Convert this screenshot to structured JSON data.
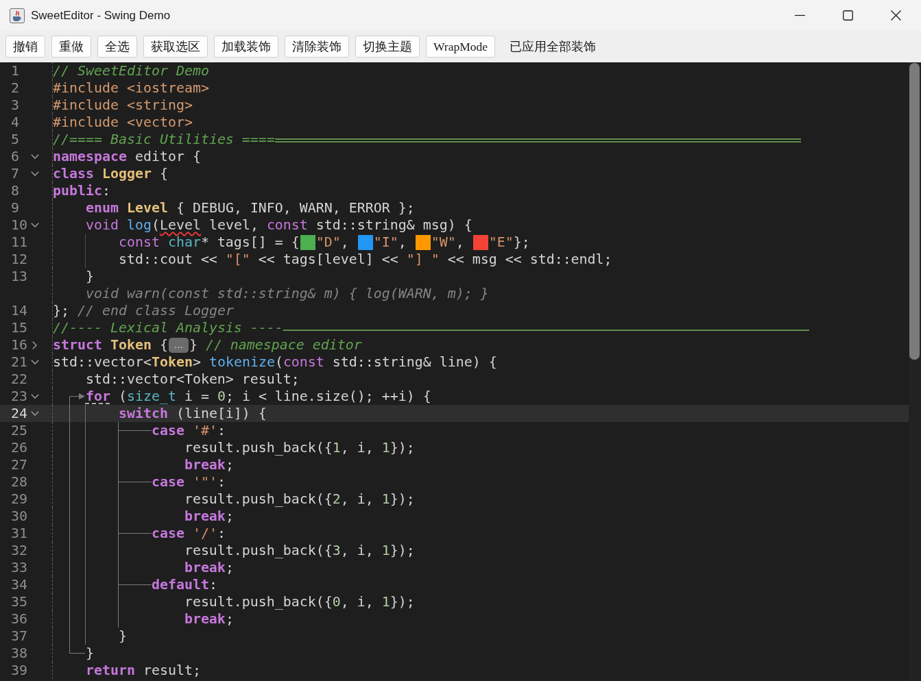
{
  "window": {
    "title": "SweetEditor - Swing Demo"
  },
  "toolbar": {
    "buttons": [
      {
        "label": "撤销"
      },
      {
        "label": "重做"
      },
      {
        "label": "全选"
      },
      {
        "label": "获取选区"
      },
      {
        "label": "加载装饰"
      },
      {
        "label": "清除装饰"
      },
      {
        "label": "切换主题"
      },
      {
        "label": "WrapMode"
      }
    ],
    "status": "已应用全部装饰"
  },
  "editor": {
    "lines": [
      {
        "number": "1",
        "current": false,
        "tokens": [
          {
            "text": "// SweetEditor Demo",
            "kind": "comment"
          }
        ]
      },
      {
        "number": "2",
        "current": false,
        "tokens": [
          {
            "text": "#include <iostream>",
            "kind": "preprocessor"
          }
        ]
      },
      {
        "number": "3",
        "current": false,
        "tokens": [
          {
            "text": "#include <string>",
            "kind": "preprocessor"
          }
        ]
      },
      {
        "number": "4",
        "current": false,
        "tokens": [
          {
            "text": "#include <vector>",
            "kind": "preprocessor"
          }
        ]
      },
      {
        "number": "5",
        "current": false,
        "tokens": [
          {
            "text": "//==== Basic Utilities ====",
            "kind": "comment"
          },
          {
            "kind": "double_rule"
          }
        ]
      },
      {
        "number": "6",
        "current": false,
        "expanded": true,
        "tokens": [
          {
            "text": "namespace ",
            "kind": "keyword"
          },
          {
            "text": "editor {",
            "kind": "plain"
          }
        ]
      },
      {
        "number": "7",
        "current": false,
        "expanded": true,
        "tokens": [
          {
            "text": "class ",
            "kind": "keyword"
          },
          {
            "text": "Logger",
            "kind": "type"
          },
          {
            "text": " {",
            "kind": "plain"
          }
        ]
      },
      {
        "number": "8",
        "current": false,
        "tokens": [
          {
            "text": "public",
            "kind": "keyword"
          },
          {
            "text": ":",
            "kind": "plain"
          }
        ],
        "children": [
          {
            "number": "9",
            "current": false,
            "tokens": [
              {
                "text": "enum ",
                "kind": "keyword"
              },
              {
                "text": "Level",
                "kind": "type"
              },
              {
                "text": " { DEBUG, INFO, WARN, ERROR };",
                "kind": "plain"
              }
            ]
          },
          {
            "number": "10",
            "current": false,
            "expanded": true,
            "tokens": [
              {
                "text": "void ",
                "kind": "modifier"
              },
              {
                "text": "log",
                "kind": "function"
              },
              {
                "text": "(",
                "kind": "plain"
              },
              {
                "text": "Level",
                "kind": "plain",
                "error": true
              },
              {
                "text": " level, ",
                "kind": "plain"
              },
              {
                "text": "const ",
                "kind": "modifier"
              },
              {
                "text": "std::string& msg) {",
                "kind": "plain"
              }
            ],
            "children": [
              {
                "number": "11",
                "current": false,
                "tokens": [
                  {
                    "text": "const ",
                    "kind": "modifier"
                  },
                  {
                    "text": "char",
                    "kind": "builtin"
                  },
                  {
                    "text": "* tags[] = {",
                    "kind": "plain"
                  },
                  {
                    "kind": "swatch",
                    "color": "#4caf50"
                  },
                  {
                    "text": "\"D\"",
                    "kind": "string"
                  },
                  {
                    "text": ", ",
                    "kind": "plain"
                  },
                  {
                    "kind": "swatch",
                    "color": "#2196f3"
                  },
                  {
                    "text": "\"I\"",
                    "kind": "string"
                  },
                  {
                    "text": ", ",
                    "kind": "plain"
                  },
                  {
                    "kind": "swatch",
                    "color": "#ff9800"
                  },
                  {
                    "text": "\"W\"",
                    "kind": "string"
                  },
                  {
                    "text": ", ",
                    "kind": "plain"
                  },
                  {
                    "kind": "swatch",
                    "color": "#f44336"
                  },
                  {
                    "text": "\"E\"",
                    "kind": "string"
                  },
                  {
                    "text": "};",
                    "kind": "plain"
                  }
                ]
              },
              {
                "number": "12",
                "current": false,
                "tokens": [
                  {
                    "text": "std::cout << ",
                    "kind": "plain"
                  },
                  {
                    "text": "\"[\"",
                    "kind": "string"
                  },
                  {
                    "text": " << tags[level] << ",
                    "kind": "plain"
                  },
                  {
                    "text": "\"] \"",
                    "kind": "string"
                  },
                  {
                    "text": " << msg << std::endl;",
                    "kind": "plain"
                  }
                ]
              }
            ]
          },
          {
            "number": "13",
            "current": false,
            "tokens": [
              {
                "text": "}",
                "kind": "plain"
              }
            ]
          },
          {
            "current": false,
            "tokens": [
              {
                "text": "void warn(const std::string& m) { log(WARN, m); }",
                "kind": "ghost"
              }
            ]
          }
        ]
      },
      {
        "number": "14",
        "current": false,
        "tokens": [
          {
            "text": "}; ",
            "kind": "plain"
          },
          {
            "text": "// end class Logger",
            "kind": "ghost"
          }
        ]
      },
      {
        "number": "15",
        "current": false,
        "tokens": [
          {
            "text": "//---- Lexical Analysis ----",
            "kind": "comment"
          },
          {
            "kind": "single_rule"
          }
        ]
      },
      {
        "number": "16",
        "current": false,
        "expanded": false,
        "tokens": [
          {
            "text": "struct ",
            "kind": "keyword"
          },
          {
            "text": "Token",
            "kind": "type"
          },
          {
            "text": " {",
            "kind": "plain"
          },
          {
            "text": "…",
            "kind": "fold_placeholder"
          },
          {
            "text": "} ",
            "kind": "plain"
          },
          {
            "text": "// namespace editor",
            "kind": "comment"
          }
        ]
      },
      {
        "number": "21",
        "current": false,
        "expanded": true,
        "tokens": [
          {
            "text": "std::vector<",
            "kind": "plain"
          },
          {
            "text": "Token",
            "kind": "type"
          },
          {
            "text": "> ",
            "kind": "plain"
          },
          {
            "text": "tokenize",
            "kind": "function"
          },
          {
            "text": "(",
            "kind": "plain"
          },
          {
            "text": "const ",
            "kind": "modifier"
          },
          {
            "text": "std::string& line) {",
            "kind": "plain"
          }
        ],
        "children": [
          {
            "number": "22",
            "current": false,
            "tokens": [
              {
                "text": "std::vector<Token> result;",
                "kind": "plain"
              }
            ]
          },
          {
            "number": "23",
            "current": false,
            "expanded": true,
            "tokens": [
              {
                "text": "for",
                "kind": "keyword",
                "underline": true
              },
              {
                "text": " (",
                "kind": "plain"
              },
              {
                "text": "size_t",
                "kind": "builtin"
              },
              {
                "text": " i = ",
                "kind": "plain"
              },
              {
                "text": "0",
                "kind": "number"
              },
              {
                "text": "; i < line.size(); ++i) {",
                "kind": "plain"
              }
            ],
            "children": [
              {
                "number": "24",
                "current": true,
                "expanded": true,
                "tokens": [
                  {
                    "text": "switch ",
                    "kind": "keyword"
                  },
                  {
                    "text": "(line[i]) {",
                    "kind": "plain"
                  }
                ],
                "children": [
                  {
                    "number": "25",
                    "current": false,
                    "tokens": [
                      {
                        "text": "case ",
                        "kind": "keyword"
                      },
                      {
                        "text": "'#'",
                        "kind": "string"
                      },
                      {
                        "text": ":",
                        "kind": "plain"
                      }
                    ],
                    "children": [
                      {
                        "number": "26",
                        "current": false,
                        "tokens": [
                          {
                            "text": "result.push_back({",
                            "kind": "plain"
                          },
                          {
                            "text": "1",
                            "kind": "number"
                          },
                          {
                            "text": ", i, ",
                            "kind": "plain"
                          },
                          {
                            "text": "1",
                            "kind": "number"
                          },
                          {
                            "text": "});",
                            "kind": "plain"
                          }
                        ]
                      },
                      {
                        "number": "27",
                        "current": false,
                        "tokens": [
                          {
                            "text": "break",
                            "kind": "keyword"
                          },
                          {
                            "text": ";",
                            "kind": "plain"
                          }
                        ]
                      }
                    ]
                  },
                  {
                    "number": "28",
                    "current": false,
                    "tokens": [
                      {
                        "text": "case ",
                        "kind": "keyword"
                      },
                      {
                        "text": "'\"'",
                        "kind": "string"
                      },
                      {
                        "text": ":",
                        "kind": "plain"
                      }
                    ],
                    "children": [
                      {
                        "number": "29",
                        "current": false,
                        "tokens": [
                          {
                            "text": "result.push_back({",
                            "kind": "plain"
                          },
                          {
                            "text": "2",
                            "kind": "number"
                          },
                          {
                            "text": ", i, ",
                            "kind": "plain"
                          },
                          {
                            "text": "1",
                            "kind": "number"
                          },
                          {
                            "text": "});",
                            "kind": "plain"
                          }
                        ]
                      },
                      {
                        "number": "30",
                        "current": false,
                        "tokens": [
                          {
                            "text": "break",
                            "kind": "keyword"
                          },
                          {
                            "text": ";",
                            "kind": "plain"
                          }
                        ]
                      }
                    ]
                  },
                  {
                    "number": "31",
                    "current": false,
                    "tokens": [
                      {
                        "text": "case ",
                        "kind": "keyword"
                      },
                      {
                        "text": "'/'",
                        "kind": "string"
                      },
                      {
                        "text": ":",
                        "kind": "plain"
                      }
                    ],
                    "children": [
                      {
                        "number": "32",
                        "current": false,
                        "tokens": [
                          {
                            "text": "result.push_back({",
                            "kind": "plain"
                          },
                          {
                            "text": "3",
                            "kind": "number"
                          },
                          {
                            "text": ", i, ",
                            "kind": "plain"
                          },
                          {
                            "text": "1",
                            "kind": "number"
                          },
                          {
                            "text": "});",
                            "kind": "plain"
                          }
                        ]
                      },
                      {
                        "number": "33",
                        "current": false,
                        "tokens": [
                          {
                            "text": "break",
                            "kind": "keyword"
                          },
                          {
                            "text": ";",
                            "kind": "plain"
                          }
                        ]
                      }
                    ]
                  },
                  {
                    "number": "34",
                    "current": false,
                    "tokens": [
                      {
                        "text": "default",
                        "kind": "keyword"
                      },
                      {
                        "text": ":",
                        "kind": "plain"
                      }
                    ],
                    "children": [
                      {
                        "number": "35",
                        "current": false,
                        "tokens": [
                          {
                            "text": "result.push_back({",
                            "kind": "plain"
                          },
                          {
                            "text": "0",
                            "kind": "number"
                          },
                          {
                            "text": ", i, ",
                            "kind": "plain"
                          },
                          {
                            "text": "1",
                            "kind": "number"
                          },
                          {
                            "text": "});",
                            "kind": "plain"
                          }
                        ]
                      },
                      {
                        "number": "36",
                        "current": false,
                        "tokens": [
                          {
                            "text": "break",
                            "kind": "keyword"
                          },
                          {
                            "text": ";",
                            "kind": "plain"
                          }
                        ]
                      }
                    ]
                  }
                ]
              },
              {
                "number": "37",
                "current": false,
                "tokens": [
                  {
                    "text": "}",
                    "kind": "plain"
                  }
                ]
              }
            ]
          },
          {
            "number": "38",
            "current": false,
            "tokens": [
              {
                "text": "}",
                "kind": "plain"
              }
            ]
          },
          {
            "number": "39",
            "current": false,
            "tokens": [
              {
                "text": "return ",
                "kind": "keyword"
              },
              {
                "text": "result;",
                "kind": "plain"
              }
            ]
          }
        ]
      }
    ]
  }
}
